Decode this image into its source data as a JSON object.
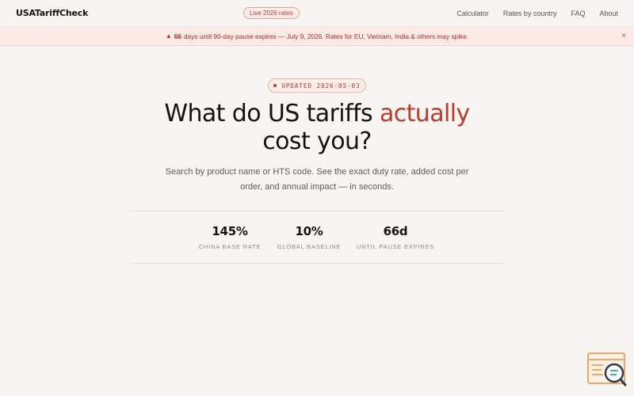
{
  "header": {
    "logo": "USATariffCheck",
    "live_badge": "Live 2026 rates",
    "nav": [
      {
        "label": "Calculator"
      },
      {
        "label": "Rates by country"
      },
      {
        "label": "FAQ"
      },
      {
        "label": "About"
      }
    ]
  },
  "banner": {
    "days": "66",
    "message": "days until 90-day pause expires — July 9, 2026. Rates for EU, Vietnam, India & others may spike.",
    "close": "×"
  },
  "hero": {
    "updated": "UPDATED  2026-05-03",
    "title_part1": "What do US tariffs ",
    "title_accent": "actually",
    "title_part2": "cost you?",
    "subtitle": "Search by product name or HTS code. See the exact duty rate, added cost per order, and annual impact — in seconds."
  },
  "stats": [
    {
      "value": "145%",
      "label": "CHINA BASE RATE"
    },
    {
      "value": "10%",
      "label": "GLOBAL BASELINE"
    },
    {
      "value": "66d",
      "label": "UNTIL PAUSE EXPIRES"
    }
  ],
  "colors": {
    "accent": "#c0392b",
    "background": "#f7f5f2"
  },
  "icons": {
    "warning": "warning-icon",
    "close": "close-icon",
    "widget": "search-document-icon"
  }
}
